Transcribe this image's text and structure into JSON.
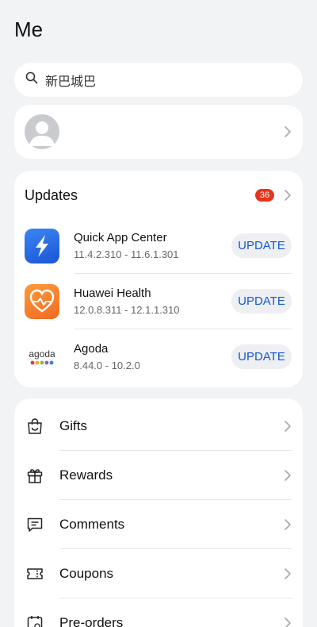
{
  "page": {
    "title": "Me"
  },
  "search": {
    "text": "新巴城巴",
    "icon": "search-icon"
  },
  "profile": {
    "avatar": "default-avatar"
  },
  "updates": {
    "title": "Updates",
    "count": "36",
    "apps": [
      {
        "name": "Quick App Center",
        "version": "11.4.2.310 - 11.6.1.301",
        "button": "UPDATE",
        "icon": "quick-app-center-icon"
      },
      {
        "name": "Huawei Health",
        "version": "12.0.8.311 - 12.1.1.310",
        "button": "UPDATE",
        "icon": "huawei-health-icon"
      },
      {
        "name": "Agoda",
        "version": "8.44.0 - 10.2.0",
        "button": "UPDATE",
        "icon": "agoda-icon",
        "logo_text": "agoda"
      }
    ]
  },
  "menu": {
    "items": [
      {
        "label": "Gifts",
        "icon": "gift-bag-icon"
      },
      {
        "label": "Rewards",
        "icon": "gift-box-icon"
      },
      {
        "label": "Comments",
        "icon": "comments-icon"
      },
      {
        "label": "Coupons",
        "icon": "coupon-icon"
      },
      {
        "label": "Pre-orders",
        "icon": "calendar-icon"
      }
    ]
  },
  "colors": {
    "accent": "#1457d6",
    "badge": "#e8341c",
    "background": "#f1f3f5"
  }
}
